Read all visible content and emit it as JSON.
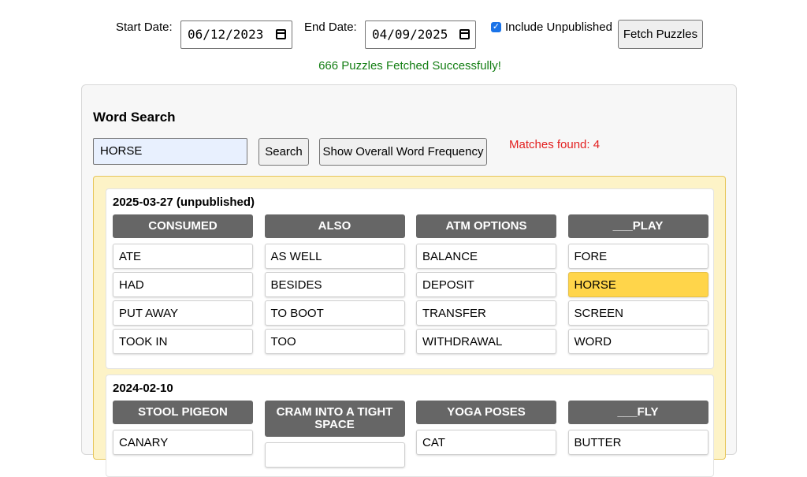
{
  "controls": {
    "start_label": "Start Date:",
    "start_value": "06/12/2023",
    "end_label": "End Date:",
    "end_value": "04/09/2025",
    "include_label": "Include Unpublished",
    "include_checked": true,
    "fetch_label": "Fetch Puzzles"
  },
  "status": "666 Puzzles Fetched Successfully!",
  "word_search": {
    "title": "Word Search",
    "query": "HORSE",
    "search_label": "Search",
    "frequency_label": "Show Overall Word Frequency",
    "matches": "Matches found: 4"
  },
  "colors": {
    "accent_green": "#137e13",
    "match_red": "#e32020",
    "highlight": "#ffd54a",
    "category_bg": "#666666"
  },
  "puzzles": [
    {
      "date": "2025-03-27 (unpublished)",
      "groups": [
        {
          "category": "CONSUMED",
          "words": [
            "ATE",
            "HAD",
            "PUT AWAY",
            "TOOK IN"
          ]
        },
        {
          "category": "ALSO",
          "words": [
            "AS WELL",
            "BESIDES",
            "TO BOOT",
            "TOO"
          ]
        },
        {
          "category": "ATM OPTIONS",
          "words": [
            "BALANCE",
            "DEPOSIT",
            "TRANSFER",
            "WITHDRAWAL"
          ]
        },
        {
          "category": "___PLAY",
          "words": [
            "FORE",
            "HORSE",
            "SCREEN",
            "WORD"
          ]
        }
      ]
    },
    {
      "date": "2024-02-10",
      "groups": [
        {
          "category": "STOOL PIGEON",
          "words": [
            "CANARY"
          ]
        },
        {
          "category": "CRAM INTO A TIGHT SPACE",
          "words": [
            ""
          ]
        },
        {
          "category": "YOGA POSES",
          "words": [
            "CAT"
          ]
        },
        {
          "category": "___FLY",
          "words": [
            "BUTTER"
          ]
        }
      ]
    }
  ]
}
